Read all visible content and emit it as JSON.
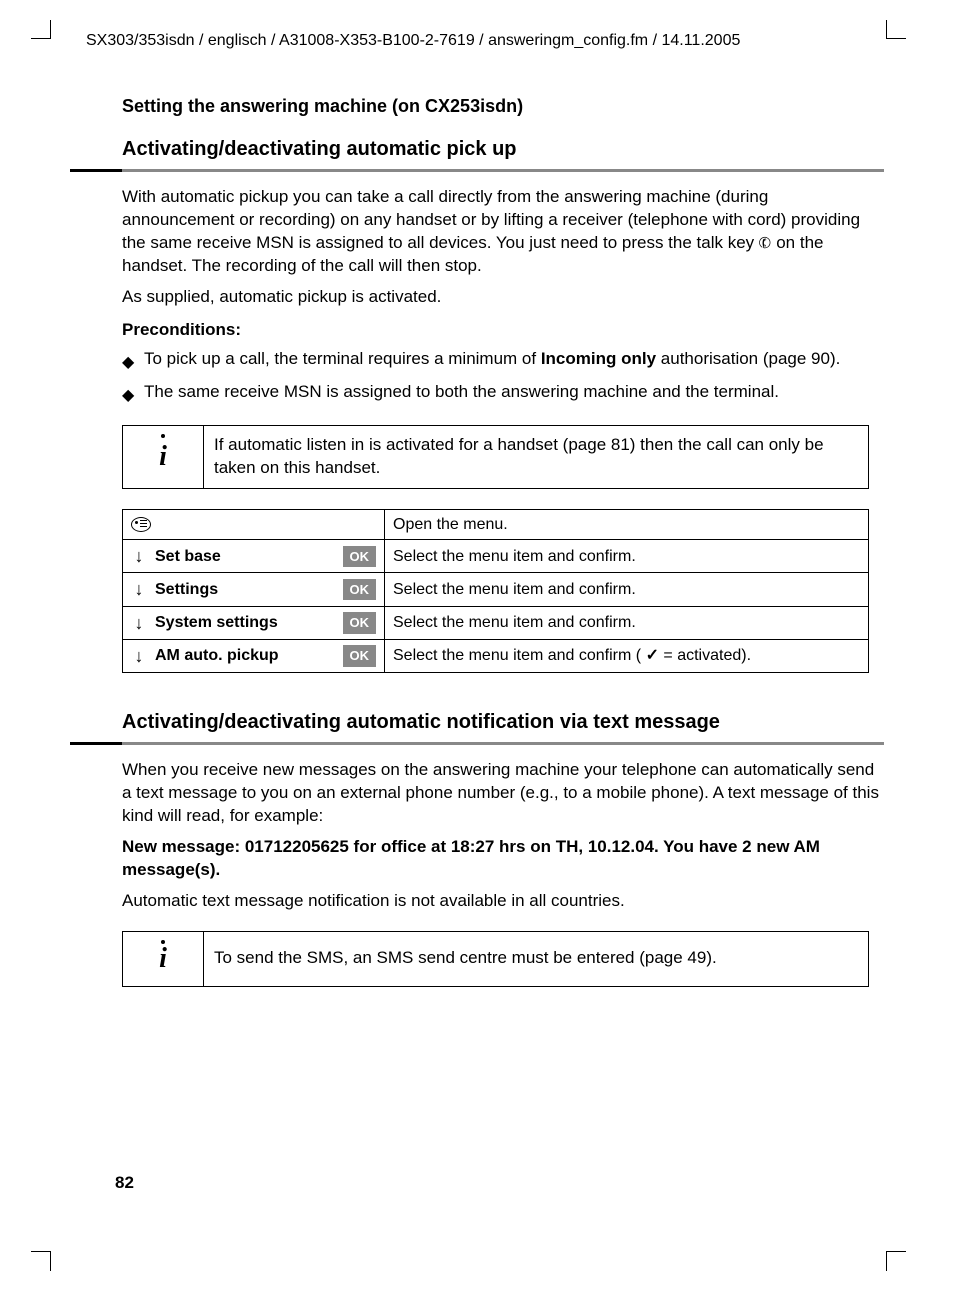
{
  "header": "SX303/353isdn / englisch / A31008-X353-B100-2-7619 / answeringm_config.fm / 14.11.2005",
  "topTitle": "Setting the answering machine (on CX253isdn)",
  "section1": {
    "heading": "Activating/deactivating automatic pick up",
    "para1a": "With automatic pickup you can take a call directly from the answering machine (during announcement or recording) on any handset or by lifting a receiver (telephone with cord) providing the same receive MSN is assigned to all devices. You just need to press the talk key ",
    "para1b": " on the handset. The recording of the call will then stop.",
    "para2": "As supplied, automatic pickup is activated.",
    "precondTitle": "Preconditions:",
    "bullets": [
      {
        "before": "To pick up a call, the terminal requires a minimum of ",
        "bold": "Incoming only",
        "after": " authorisation (page 90)."
      },
      {
        "before": "The same receive MSN is assigned to both the answering machine and the terminal.",
        "bold": "",
        "after": ""
      }
    ],
    "info": "If automatic listen in is activated for a handset (page 81) then the call can only be taken on this handset.",
    "menu": [
      {
        "icon": "menu",
        "label": "",
        "ok": false,
        "desc": "Open the menu."
      },
      {
        "icon": "down",
        "label": "Set base",
        "ok": true,
        "desc": "Select the menu item and confirm."
      },
      {
        "icon": "down",
        "label": "Settings",
        "ok": true,
        "desc": "Select the menu item and confirm."
      },
      {
        "icon": "down",
        "label": "System settings",
        "ok": true,
        "desc": "Select the menu item and confirm."
      },
      {
        "icon": "down",
        "label": "AM auto. pickup",
        "ok": true,
        "desc_before": "Select the menu item and confirm ( ",
        "desc_after": " = activated)."
      }
    ]
  },
  "section2": {
    "heading": "Activating/deactivating automatic notification via text message",
    "para1": "When you receive new messages on the answering machine your telephone can automatically send a text message to you on an external phone number (e.g., to a mobile phone). A text message of this kind will read, for example:",
    "para2": "New message: 01712205625 for office at 18:27 hrs on TH, 10.12.04. You have 2 new AM message(s).",
    "para3": "Automatic text message notification is not available in all countries.",
    "info": "To send the SMS, an SMS send centre must be entered (page 49)."
  },
  "pageNumber": "82",
  "ok_label": "OK"
}
